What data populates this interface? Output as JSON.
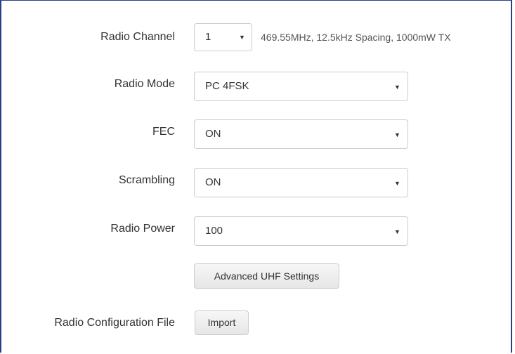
{
  "channel": {
    "label": "Radio Channel",
    "value": "1",
    "info": "469.55MHz, 12.5kHz Spacing, 1000mW TX"
  },
  "mode": {
    "label": "Radio Mode",
    "value": "PC 4FSK"
  },
  "fec": {
    "label": "FEC",
    "value": "ON"
  },
  "scrambling": {
    "label": "Scrambling",
    "value": "ON"
  },
  "power": {
    "label": "Radio Power",
    "value": "100"
  },
  "advanced_button": "Advanced UHF Settings",
  "config_file": {
    "label": "Radio Configuration File",
    "button": "Import"
  },
  "caret_glyph": "▼",
  "colors": {
    "frame": "#2b3f86",
    "border": "#cccccc",
    "text": "#333333"
  }
}
